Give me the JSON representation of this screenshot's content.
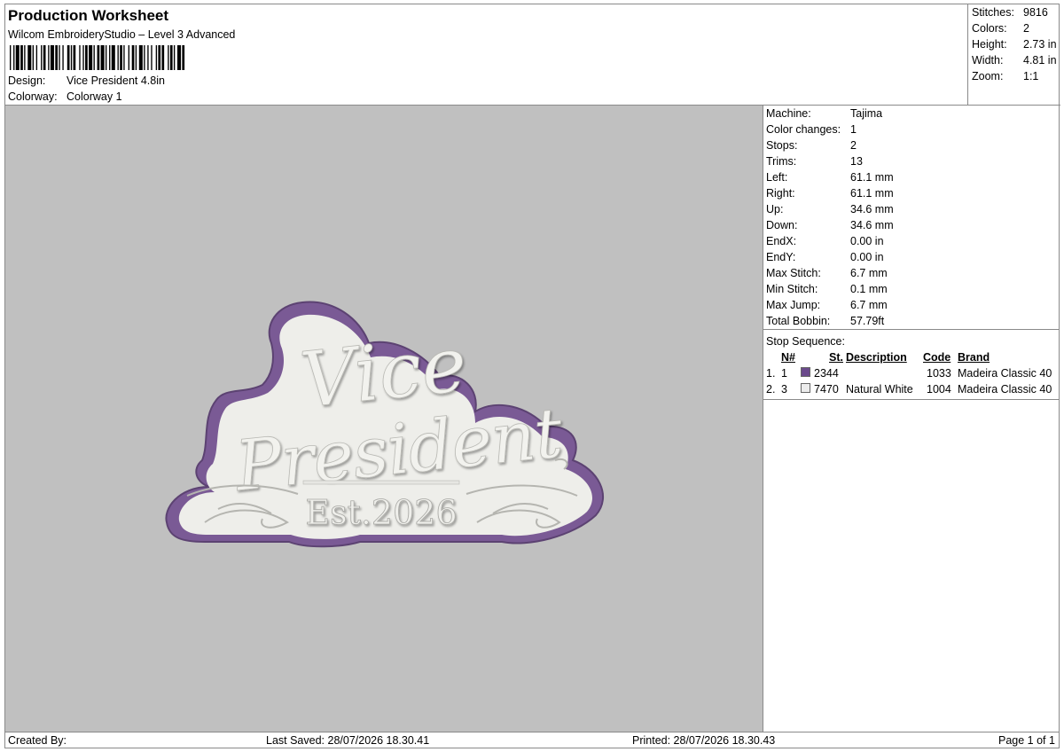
{
  "header": {
    "title": "Production Worksheet",
    "subtitle": "Wilcom EmbroideryStudio – Level 3 Advanced",
    "design_label": "Design:",
    "design_value": "Vice President 4.8in",
    "colorway_label": "Colorway:",
    "colorway_value": "Colorway 1"
  },
  "top_stats": [
    {
      "label": "Stitches:",
      "value": "9816"
    },
    {
      "label": "Colors:",
      "value": "2"
    },
    {
      "label": "Height:",
      "value": "2.73 in"
    },
    {
      "label": "Width:",
      "value": "4.81 in"
    },
    {
      "label": "Zoom:",
      "value": "1:1"
    }
  ],
  "machine_info": [
    {
      "label": "Machine:",
      "value": "Tajima"
    },
    {
      "label": "Color changes:",
      "value": "1"
    },
    {
      "label": "Stops:",
      "value": "2"
    },
    {
      "label": "Trims:",
      "value": "13"
    },
    {
      "label": "Left:",
      "value": "61.1 mm"
    },
    {
      "label": "Right:",
      "value": "61.1 mm"
    },
    {
      "label": "Up:",
      "value": "34.6 mm"
    },
    {
      "label": "Down:",
      "value": "34.6 mm"
    },
    {
      "label": "EndX:",
      "value": "0.00 in"
    },
    {
      "label": "EndY:",
      "value": "0.00 in"
    },
    {
      "label": "Max Stitch:",
      "value": "6.7 mm"
    },
    {
      "label": "Min Stitch:",
      "value": "0.1 mm"
    },
    {
      "label": "Max Jump:",
      "value": "6.7 mm"
    },
    {
      "label": "Total Bobbin:",
      "value": "57.79ft"
    }
  ],
  "stop_sequence": {
    "title": "Stop Sequence:",
    "headers": {
      "n": "N#",
      "st": "St.",
      "description": "Description",
      "code": "Code",
      "brand": "Brand"
    },
    "rows": [
      {
        "idx": "1.",
        "n": "1",
        "color": "#6b4a8c",
        "st": "2344",
        "description": "",
        "code": "1033",
        "brand": "Madeira Classic 40"
      },
      {
        "idx": "2.",
        "n": "3",
        "color": "#ececec",
        "st": "7470",
        "description": "Natural White",
        "code": "1004",
        "brand": "Madeira Classic 40"
      }
    ]
  },
  "design_art": {
    "line1": "Vice",
    "line2": "President",
    "line3": "Est.2026",
    "outline_color": "#7a5a95",
    "fill_color": "#eeeeea"
  },
  "footer": {
    "created_by": "Created By:",
    "last_saved": "Last Saved: 28/07/2026 18.30.41",
    "printed": "Printed: 28/07/2026 18.30.43",
    "page": "Page 1 of 1"
  }
}
